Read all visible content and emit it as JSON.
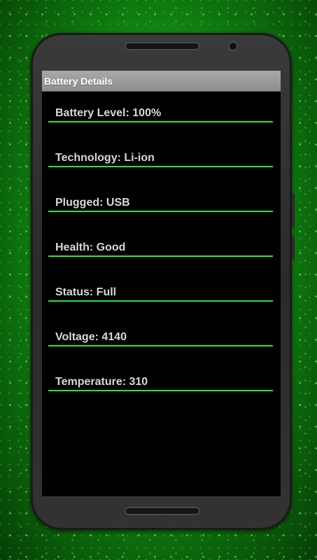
{
  "app": {
    "title": "Battery Details"
  },
  "details": [
    {
      "text": "Battery Level: 100%"
    },
    {
      "text": "Technology: Li-ion"
    },
    {
      "text": "Plugged: USB"
    },
    {
      "text": "Health: Good"
    },
    {
      "text": "Status: Full"
    },
    {
      "text": "Voltage: 4140"
    },
    {
      "text": "Temperature: 310"
    }
  ],
  "colors": {
    "accent_line": "#2ee62e",
    "background": "#000000",
    "titlebar": "#9a9a9a"
  }
}
